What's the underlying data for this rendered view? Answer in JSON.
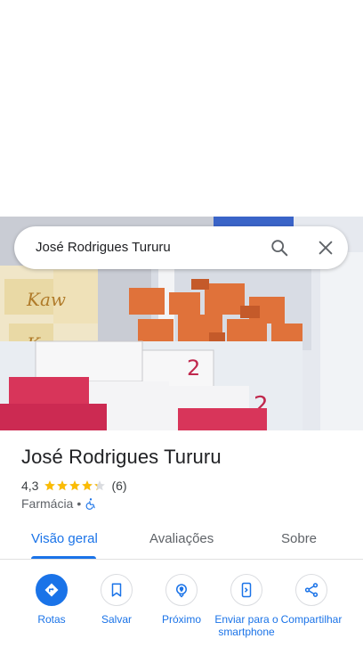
{
  "search": {
    "query": "José Rodrigues Tururu"
  },
  "place": {
    "title": "José Rodrigues Tururu",
    "rating": "4,3",
    "stars": 4.3,
    "review_count": "(6)",
    "category": "Farmácia",
    "separator": "•"
  },
  "tabs": [
    {
      "label": "Visão geral",
      "active": true
    },
    {
      "label": "Avaliações",
      "active": false
    },
    {
      "label": "Sobre",
      "active": false
    }
  ],
  "actions": [
    {
      "label": "Rotas",
      "icon": "directions-icon"
    },
    {
      "label": "Salvar",
      "icon": "bookmark-icon"
    },
    {
      "label": "Próximo",
      "icon": "nearby-icon"
    },
    {
      "label": "Enviar para o smartphone",
      "icon": "send-to-phone-icon"
    },
    {
      "label": "Compartilhar",
      "icon": "share-icon"
    }
  ],
  "colors": {
    "accent": "#1a73e8",
    "star": "#fbbc04"
  }
}
